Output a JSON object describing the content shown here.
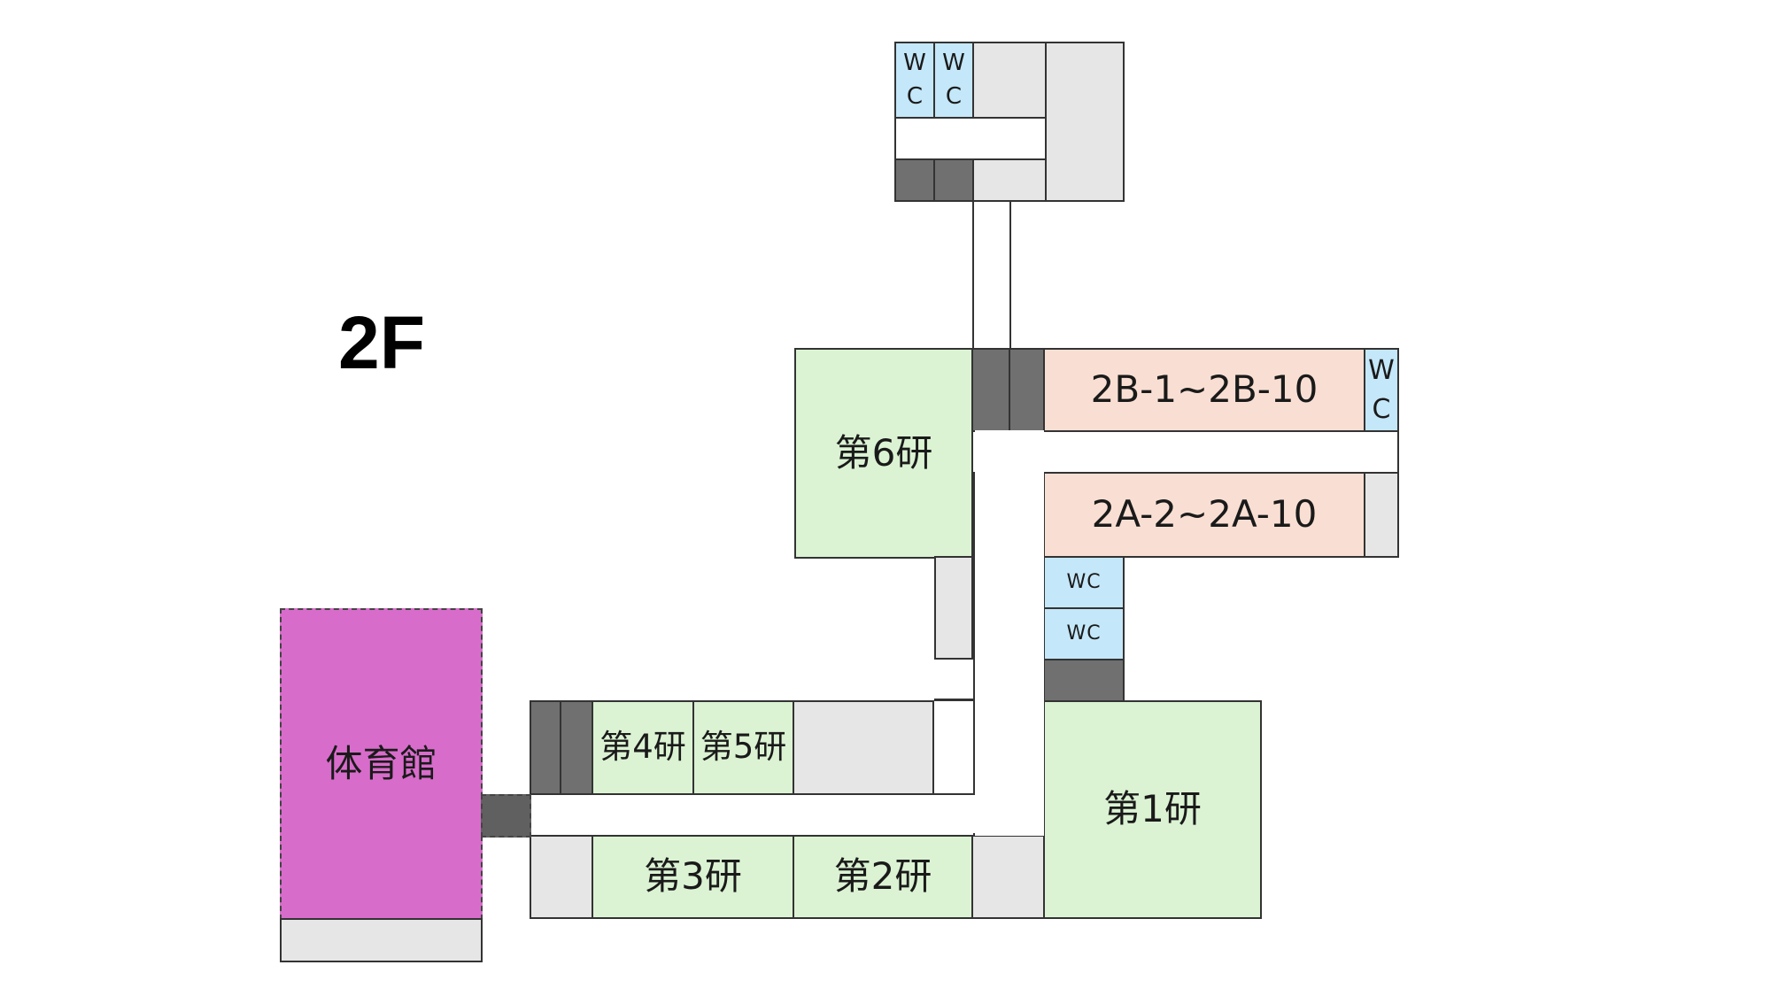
{
  "floor": "2F",
  "rooms": {
    "lab1": "第1研",
    "lab2": "第2研",
    "lab3": "第3研",
    "lab4": "第4研",
    "lab5": "第5研",
    "lab6": "第6研",
    "class_2b": "2B-1~2B-10",
    "class_2a": "2A-2~2A-10",
    "gym": "体育館",
    "wc_vertical": "W\nC",
    "wc_horizontal": "WC"
  },
  "colors": {
    "lab": "#dbf3d3",
    "classroom": "#f9dfd3",
    "toilet": "#c4e7f9",
    "gym": "#d86ccb",
    "stairs": "#707070",
    "storage": "#e6e6e6"
  }
}
